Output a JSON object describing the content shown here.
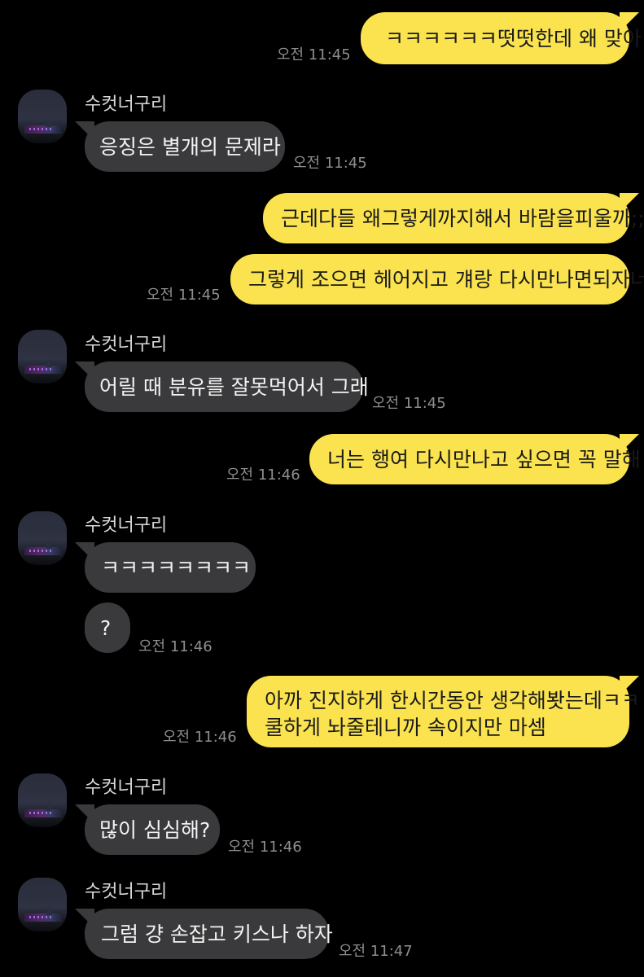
{
  "contact_name": "수컷너구리",
  "colors": {
    "background": "#000000",
    "outgoing_bubble": "#FAE34E",
    "incoming_bubble": "#3a3a3c",
    "timestamp": "#8e8e8e"
  },
  "messages": [
    {
      "dir": "out",
      "text": "ㅋㅋㅋㅋㅋㅋ떳떳한데 왜 맞아",
      "time": "오전 11:45"
    },
    {
      "dir": "in",
      "text": "응징은 별개의 문제라",
      "time": "오전 11:45"
    },
    {
      "dir": "out",
      "text": "근데다들 왜그렇게까지해서 바람을피울까;;",
      "time": ""
    },
    {
      "dir": "out",
      "text": "그렇게 조으면 헤어지고 걔랑 다시만나면되자너",
      "time": "오전 11:45"
    },
    {
      "dir": "in",
      "text": "어릴 때 분유를 잘못먹어서 그래",
      "time": "오전 11:45"
    },
    {
      "dir": "out",
      "text": "너는 행여 다시만나고 싶으면 꼭 말해",
      "time": "오전 11:46"
    },
    {
      "dir": "in",
      "text": "ㅋㅋㅋㅋㅋㅋㅋㅋ",
      "time": ""
    },
    {
      "dir": "in",
      "text": "?",
      "time": "오전 11:46"
    },
    {
      "dir": "out",
      "line1": "아까 진지하게 한시간동안 생각해봣는데ㅋㅋ",
      "line2": "쿨하게 놔줄테니까 속이지만 마셈",
      "time": "오전 11:46"
    },
    {
      "dir": "in",
      "text": "많이 심심해?",
      "time": "오전 11:46"
    },
    {
      "dir": "in",
      "text": "그럼 걍 손잡고 키스나 하자",
      "time": "오전 11:47"
    }
  ]
}
